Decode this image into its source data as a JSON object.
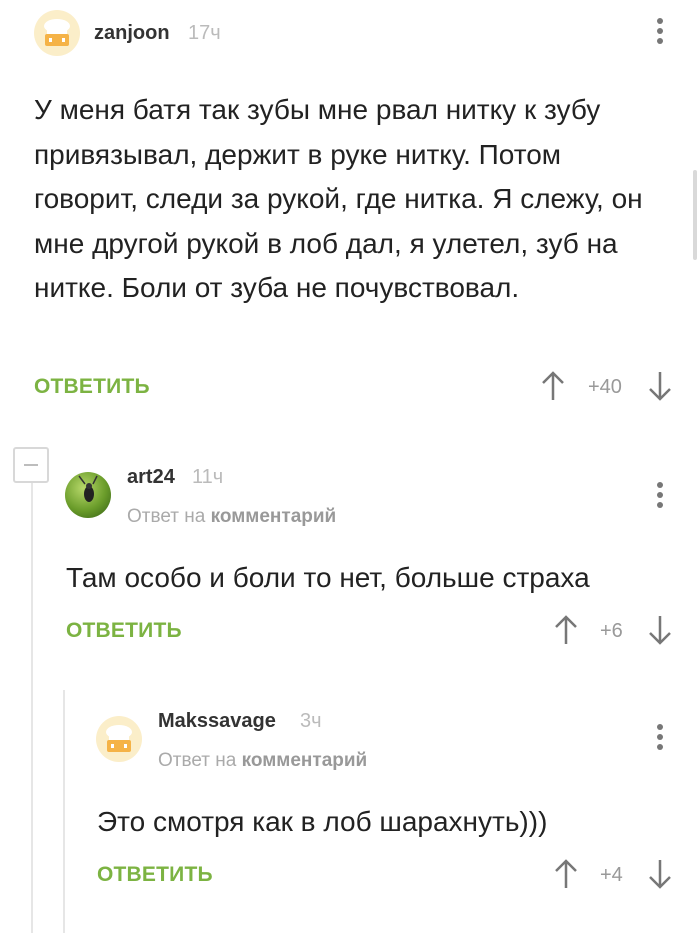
{
  "comments": [
    {
      "author": "zanjoon",
      "time": "17ч",
      "body": "У меня батя так зубы мне рвал нитку к зубу привязывал, держит в руке нитку. Потом говорит, следи за рукой, где нитка. Я слежу, он мне другой рукой в лоб дал, я улетел, зуб на нитке. Боли от зуба не почувствовал.",
      "reply_label": "ОТВЕТИТЬ",
      "rating": "+40",
      "avatar": "chef-hat-avatar"
    },
    {
      "author": "art24",
      "time": "11ч",
      "reply_prefix": "Ответ на",
      "reply_target": "комментарий",
      "body": "Там особо и боли то нет, больше страха",
      "reply_label": "ОТВЕТИТЬ",
      "rating": "+6",
      "avatar": "grasshopper-avatar"
    },
    {
      "author": "Makssavage",
      "time": "3ч",
      "reply_prefix": "Ответ на",
      "reply_target": "комментарий",
      "body": "Это смотря как в лоб шарахнуть)))",
      "reply_label": "ОТВЕТИТЬ",
      "rating": "+4",
      "avatar": "chef-hat-avatar"
    }
  ],
  "colors": {
    "accent": "#7cb342",
    "muted": "#aaaaaa",
    "text": "#222222"
  }
}
